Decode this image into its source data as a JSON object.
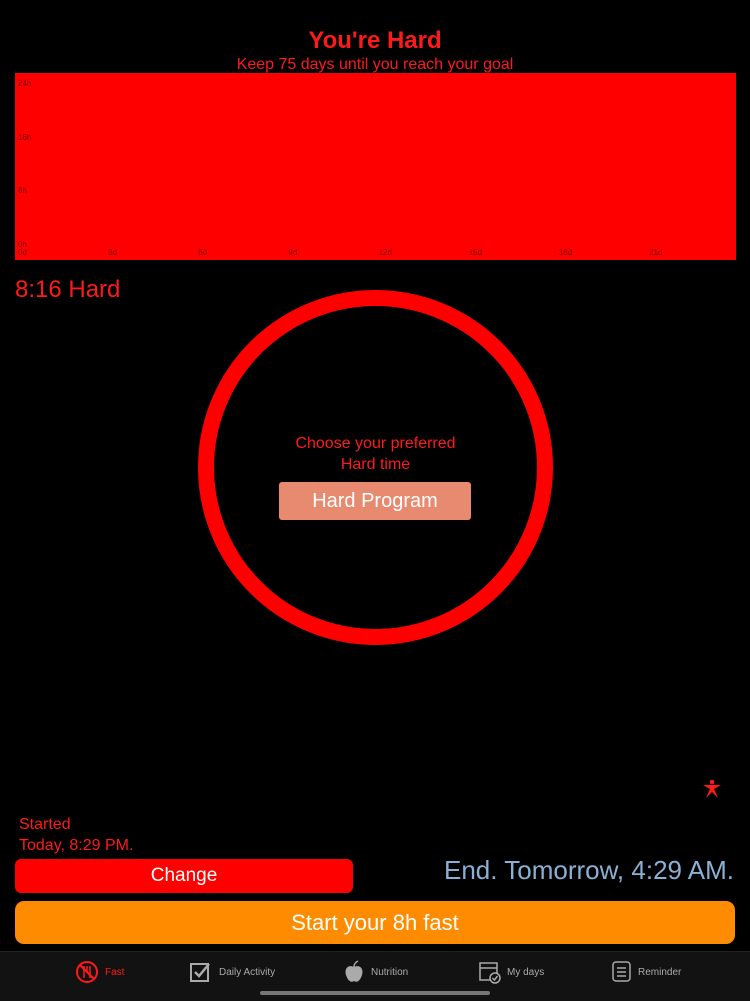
{
  "header": {
    "title": "You're Hard",
    "subtitle": "Keep 75 days until you reach your goal"
  },
  "chart_data": {
    "type": "area",
    "y_ticks": [
      "24h",
      "16h",
      "8h",
      "0h"
    ],
    "x_ticks": [
      "0d",
      "3d",
      "6d",
      "9d",
      "12d",
      "15d",
      "18d",
      "21d"
    ],
    "ylim": [
      0,
      24
    ],
    "xlim": [
      0,
      24
    ],
    "fill_color": "#ff0000",
    "fill_level": 24
  },
  "ratio_label": "8:16 Hard",
  "ring": {
    "prompt_line1": "Choose your preferred",
    "prompt_line2": "Hard time",
    "program_button": "Hard Program"
  },
  "star_icon": "star-person-icon",
  "started": {
    "line1": "Started",
    "line2": "Today, 8:29 PM."
  },
  "change_button": "Change",
  "end_text": "End. Tomorrow, 4:29 AM.",
  "start_button": "Start your 8h fast",
  "tabs": [
    {
      "label": "Fast",
      "icon": "no-food-icon",
      "active": true
    },
    {
      "label": "Daily Activity",
      "icon": "checkbox-icon",
      "active": false
    },
    {
      "label": "Nutrition",
      "icon": "apple-icon",
      "active": false
    },
    {
      "label": "My days",
      "icon": "calendar-check-icon",
      "active": false
    },
    {
      "label": "Reminder",
      "icon": "list-icon",
      "active": false
    }
  ],
  "colors": {
    "accent_red": "#ff0000",
    "orange": "#ff8c00",
    "end_text_blue": "#8ab0d6",
    "program_button_bg": "#e88a6f"
  }
}
